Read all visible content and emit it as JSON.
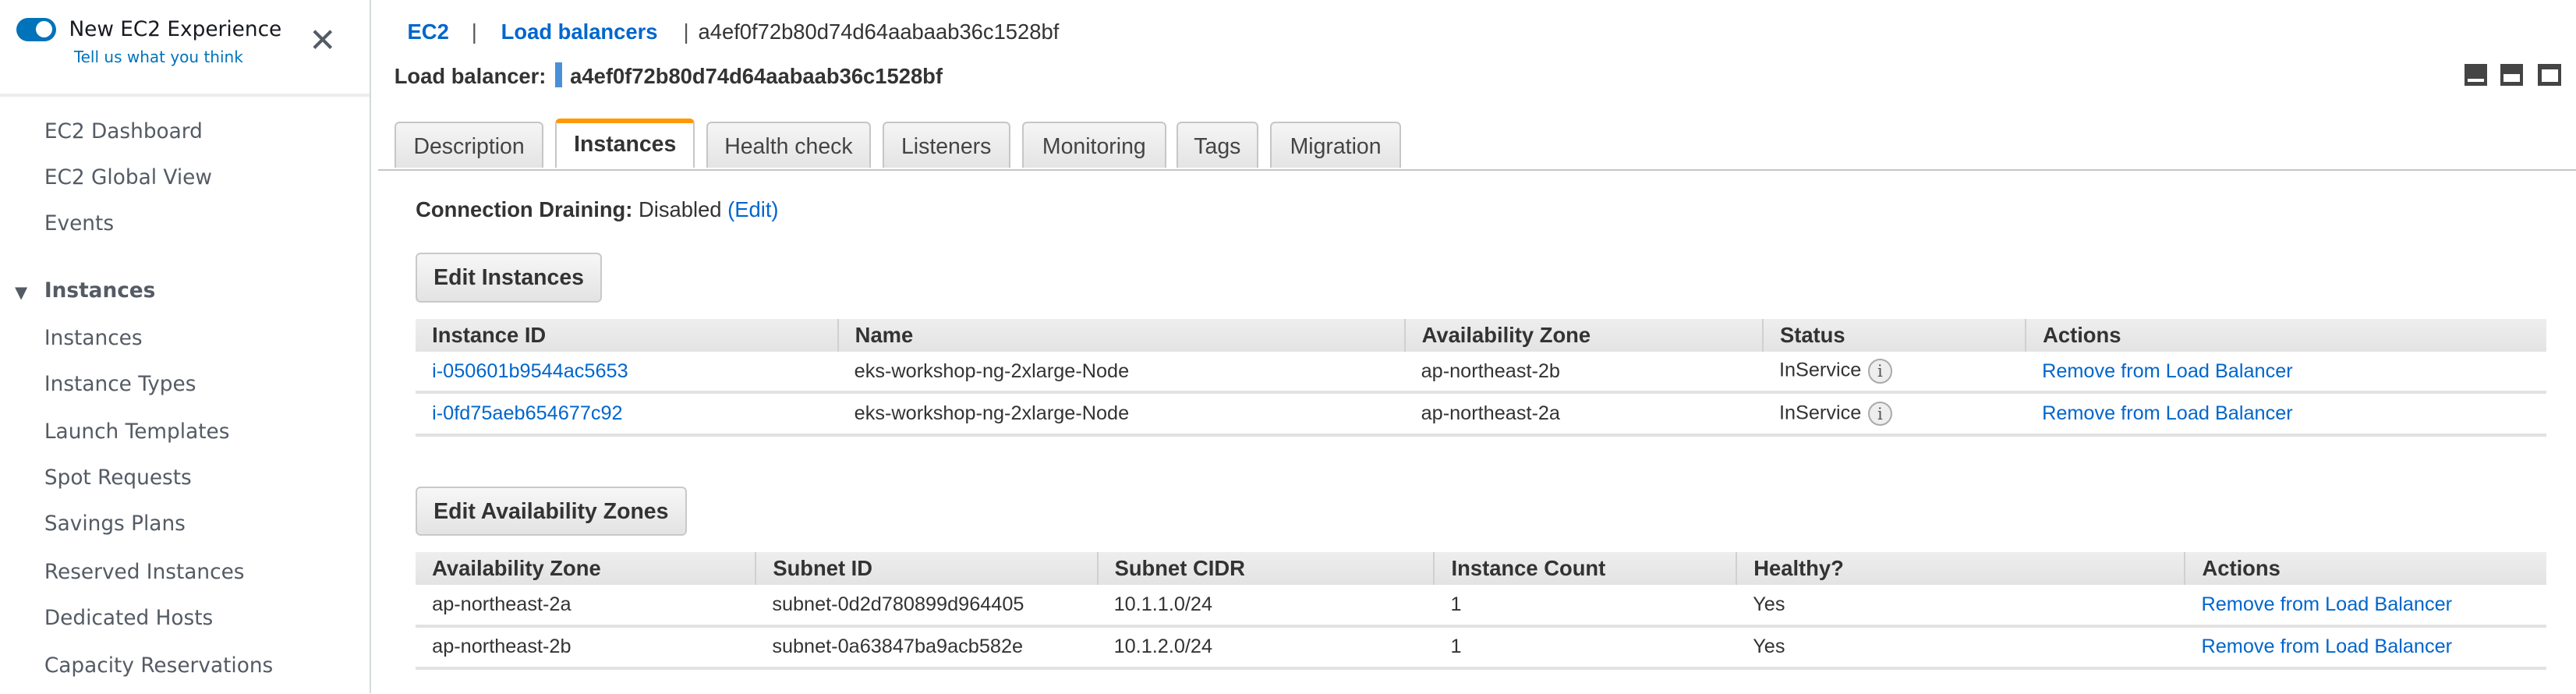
{
  "sidebar": {
    "toggle_label": "New EC2 Experience",
    "feedback_link": "Tell us what you think",
    "close_glyph": "✕",
    "top_items": [
      "EC2 Dashboard",
      "EC2 Global View",
      "Events"
    ],
    "group_label": "Instances",
    "group_items": [
      "Instances",
      "Instance Types",
      "Launch Templates",
      "Spot Requests",
      "Savings Plans",
      "Reserved Instances",
      "Dedicated Hosts",
      "Capacity Reservations"
    ]
  },
  "breadcrumb": {
    "root": "EC2",
    "sep": "|",
    "section": "Load balancers",
    "current": "a4ef0f72b80d74d64aabaab36c1528bf"
  },
  "header": {
    "label": "Load balancer:",
    "name": "a4ef0f72b80d74d64aabaab36c1528bf"
  },
  "tabs": [
    "Description",
    "Instances",
    "Health check",
    "Listeners",
    "Monitoring",
    "Tags",
    "Migration"
  ],
  "active_tab": "Instances",
  "connection_draining": {
    "label": "Connection Draining:",
    "value": "Disabled",
    "edit": "(Edit)"
  },
  "instances": {
    "button": "Edit Instances",
    "columns": [
      "Instance ID",
      "Name",
      "Availability Zone",
      "Status",
      "Actions"
    ],
    "rows": [
      {
        "id": "i-050601b9544ac5653",
        "name": "eks-workshop-ng-2xlarge-Node",
        "az": "ap-northeast-2b",
        "status": "InService",
        "action": "Remove from Load Balancer"
      },
      {
        "id": "i-0fd75aeb654677c92",
        "name": "eks-workshop-ng-2xlarge-Node",
        "az": "ap-northeast-2a",
        "status": "InService",
        "action": "Remove from Load Balancer"
      }
    ]
  },
  "zones": {
    "button": "Edit Availability Zones",
    "columns": [
      "Availability Zone",
      "Subnet ID",
      "Subnet CIDR",
      "Instance Count",
      "Healthy?",
      "Actions"
    ],
    "rows": [
      {
        "az": "ap-northeast-2a",
        "subnet": "subnet-0d2d780899d964405",
        "cidr": "10.1.1.0/24",
        "count": "1",
        "healthy": "Yes",
        "action": "Remove from Load Balancer"
      },
      {
        "az": "ap-northeast-2b",
        "subnet": "subnet-0a63847ba9acb582e",
        "cidr": "10.1.2.0/24",
        "count": "1",
        "healthy": "Yes",
        "action": "Remove from Load Balancer"
      }
    ]
  },
  "colors": {
    "link": "#0066cc",
    "accent": "#ff9900",
    "toggle": "#0073bb"
  }
}
